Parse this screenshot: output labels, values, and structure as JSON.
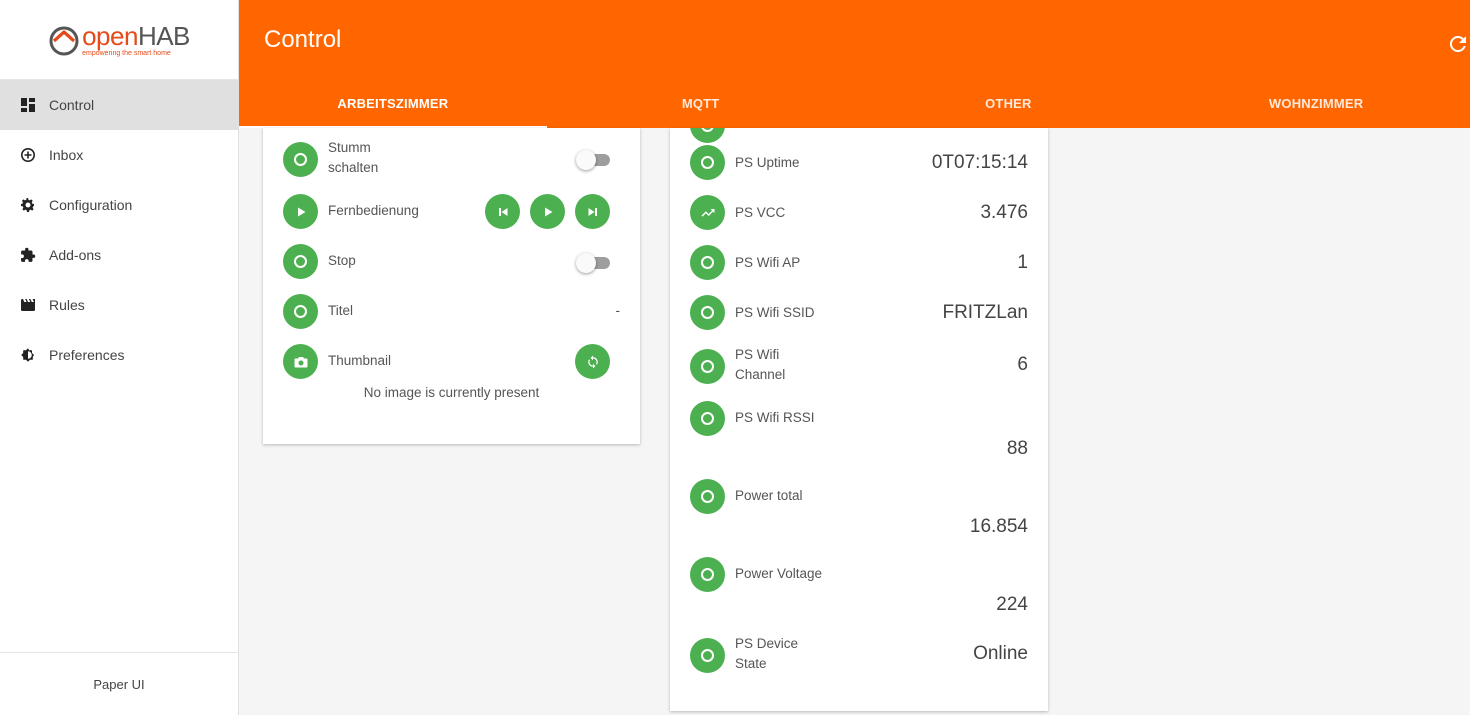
{
  "app": {
    "logo_open": "open",
    "logo_hab": "HAB",
    "logo_tagline": "empowering the smart home",
    "footer": "Paper UI"
  },
  "sidebar": {
    "items": [
      {
        "label": "Control",
        "icon": "dashboard-icon"
      },
      {
        "label": "Inbox",
        "icon": "plus-circle-icon"
      },
      {
        "label": "Configuration",
        "icon": "gear-icon"
      },
      {
        "label": "Add-ons",
        "icon": "puzzle-icon"
      },
      {
        "label": "Rules",
        "icon": "clapperboard-icon"
      },
      {
        "label": "Preferences",
        "icon": "brightness-icon"
      }
    ]
  },
  "header": {
    "title": "Control",
    "tabs": [
      "ARBEITSZIMMER",
      "MQTT",
      "OTHER",
      "WOHNZIMMER"
    ]
  },
  "card1": {
    "rows": [
      {
        "label": "Stumm\nschalten"
      },
      {
        "label": "Fernbedienung"
      },
      {
        "label": "Stop"
      },
      {
        "label": "Titel",
        "value": "-"
      },
      {
        "label": "Thumbnail"
      }
    ],
    "no_image": "No image is currently present"
  },
  "card2": {
    "rows": [
      {
        "label": "PS Uptime",
        "value": "0T07:15:14"
      },
      {
        "label": "PS VCC",
        "value": "3.476"
      },
      {
        "label": "PS Wifi AP",
        "value": "1"
      },
      {
        "label": "PS Wifi SSID",
        "value": "FRITZLan"
      },
      {
        "label": "PS Wifi\nChannel",
        "value": "6"
      },
      {
        "label": "PS Wifi RSSI",
        "value": "88"
      },
      {
        "label": "Power total",
        "value": "16.854"
      },
      {
        "label": "Power Voltage",
        "value": "224"
      },
      {
        "label": "PS Device\nState",
        "value": "Online"
      }
    ]
  },
  "colors": {
    "accent": "#ff6600",
    "item_icon": "#4caf50"
  }
}
